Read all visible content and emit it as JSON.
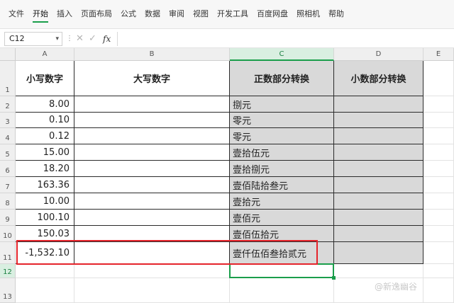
{
  "menu": {
    "items": [
      "文件",
      "开始",
      "插入",
      "页面布局",
      "公式",
      "数据",
      "审阅",
      "视图",
      "开发工具",
      "百度网盘",
      "照相机",
      "帮助"
    ],
    "active_index": 1
  },
  "formula_bar": {
    "name_box": "C12",
    "fx_label": "fx",
    "formula": ""
  },
  "columns": [
    "A",
    "B",
    "C",
    "D",
    "E"
  ],
  "rows": [
    "1",
    "2",
    "3",
    "4",
    "5",
    "6",
    "7",
    "8",
    "9",
    "10",
    "11",
    "12",
    "13"
  ],
  "table": {
    "headers": [
      "小写数字",
      "大写数字",
      "正数部分转换",
      "小数部分转换"
    ],
    "data": [
      {
        "a": "8.00",
        "b": "",
        "c": "捌元",
        "d": ""
      },
      {
        "a": "0.10",
        "b": "",
        "c": "零元",
        "d": ""
      },
      {
        "a": "0.12",
        "b": "",
        "c": "零元",
        "d": ""
      },
      {
        "a": "15.00",
        "b": "",
        "c": "壹拾伍元",
        "d": ""
      },
      {
        "a": "18.20",
        "b": "",
        "c": "壹拾捌元",
        "d": ""
      },
      {
        "a": "163.36",
        "b": "",
        "c": "壹佰陆拾叁元",
        "d": ""
      },
      {
        "a": "10.00",
        "b": "",
        "c": "壹拾元",
        "d": ""
      },
      {
        "a": "100.10",
        "b": "",
        "c": "壹佰元",
        "d": ""
      },
      {
        "a": "150.03",
        "b": "",
        "c": "壹佰伍拾元",
        "d": ""
      },
      {
        "a": "-1,532.10",
        "b": "",
        "c": "壹仟伍佰叁拾贰元",
        "d": ""
      }
    ]
  },
  "colors": {
    "accent": "#1a9e4b",
    "highlight": "#e5242b",
    "gray_fill": "#d9d9d9"
  },
  "watermark": "@新逸幽谷"
}
